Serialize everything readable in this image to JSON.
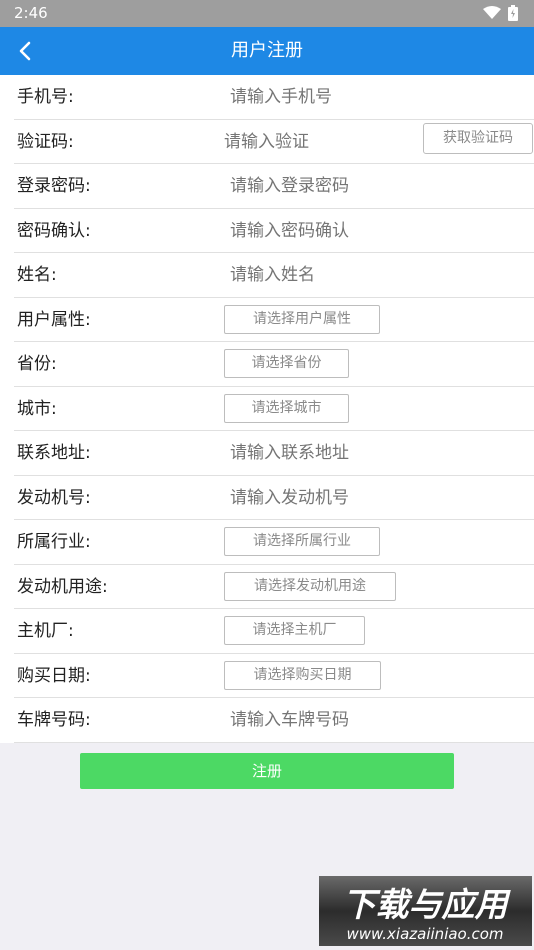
{
  "status_bar": {
    "time": "2:46"
  },
  "app_bar": {
    "title": "用户注册"
  },
  "form": {
    "phone_label": "手机号:",
    "phone_placeholder": "请输入手机号",
    "code_label": "验证码:",
    "code_placeholder": "请输入验证",
    "get_code_label": "获取验证码",
    "password_label": "登录密码:",
    "password_placeholder": "请输入登录密码",
    "confirm_label": "密码确认:",
    "confirm_placeholder": "请输入密码确认",
    "name_label": "姓名:",
    "name_placeholder": "请输入姓名",
    "user_type_label": "用户属性:",
    "user_type_select": "请选择用户属性",
    "province_label": "省份:",
    "province_select": "请选择省份",
    "city_label": "城市:",
    "city_select": "请选择城市",
    "address_label": "联系地址:",
    "address_placeholder": "请输入联系地址",
    "engine_no_label": "发动机号:",
    "engine_no_placeholder": "请输入发动机号",
    "industry_label": "所属行业:",
    "industry_select": "请选择所属行业",
    "engine_use_label": "发动机用途:",
    "engine_use_select": "请选择发动机用途",
    "oem_label": "主机厂:",
    "oem_select": "请选择主机厂",
    "purchase_date_label": "购买日期:",
    "purchase_date_select": "请选择购买日期",
    "plate_label": "车牌号码:",
    "plate_placeholder": "请输入车牌号码"
  },
  "register_label": "注册",
  "watermark": {
    "title": "下载与应用",
    "url": "www.xiazaiiniao.com"
  },
  "colors": {
    "app_bar": "#1e88e5",
    "register_button": "#4cd964",
    "status_bar": "#9e9e9e"
  }
}
